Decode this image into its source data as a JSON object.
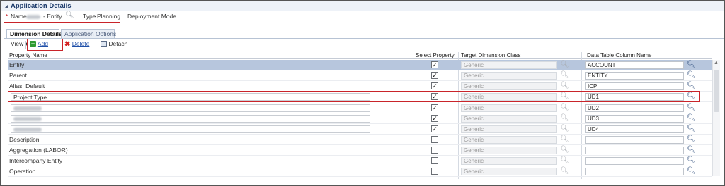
{
  "app_header": {
    "title": "Application Details"
  },
  "info": {
    "required_marker": "*",
    "name_label": "Name",
    "name_value_suffix": "- Entity",
    "type_label": "Type",
    "type_value": "Planning",
    "deployment_label": "Deployment Mode"
  },
  "tabs": [
    {
      "label": "Dimension Details",
      "active": true
    },
    {
      "label": "Application Options",
      "active": false
    }
  ],
  "toolbar": {
    "view_label": "View",
    "add_label": "Add",
    "delete_label": "Delete",
    "detach_label": "Detach"
  },
  "columns": {
    "property_name": "Property Name",
    "select_property": "Select Property",
    "target_dimension_class": "Target Dimension Class",
    "data_table_column_name": "Data Table Column Name"
  },
  "rows": [
    {
      "name": "Entity",
      "checked": true,
      "target": "Generic",
      "column": "ACCOUNT",
      "selected": true
    },
    {
      "name": "Parent",
      "checked": true,
      "target": "Generic",
      "column": "ENTITY"
    },
    {
      "name": "Alias: Default",
      "checked": true,
      "target": "Generic",
      "column": "ICP"
    },
    {
      "name": "Project Type",
      "checked": true,
      "target": "Generic",
      "column": "UD1",
      "input": true,
      "highlight": true
    },
    {
      "name": "",
      "checked": true,
      "target": "Generic",
      "column": "UD2",
      "input": true,
      "redacted": true
    },
    {
      "name": "",
      "checked": true,
      "target": "Generic",
      "column": "UD3",
      "input": true,
      "redacted": true
    },
    {
      "name": "",
      "checked": true,
      "target": "Generic",
      "column": "UD4",
      "input": true,
      "redacted": true
    },
    {
      "name": "Description",
      "checked": false,
      "target": "Generic",
      "column": ""
    },
    {
      "name": "Aggregation (LABOR)",
      "checked": false,
      "target": "Generic",
      "column": ""
    },
    {
      "name": "Intercompany Entity",
      "checked": false,
      "target": "Generic",
      "column": ""
    },
    {
      "name": "Operation",
      "checked": false,
      "target": "Generic",
      "column": ""
    }
  ],
  "colors": {
    "highlight_border": "#c9242a",
    "selected_row": "#b7c6dd",
    "add_icon": "#2e9b32",
    "delete_icon": "#d32020"
  },
  "icons": [
    "collapse-triangle-icon",
    "search-icon",
    "plus-icon",
    "delete-x-icon",
    "detach-icon",
    "magnifier-icon",
    "checkbox-check-icon"
  ]
}
